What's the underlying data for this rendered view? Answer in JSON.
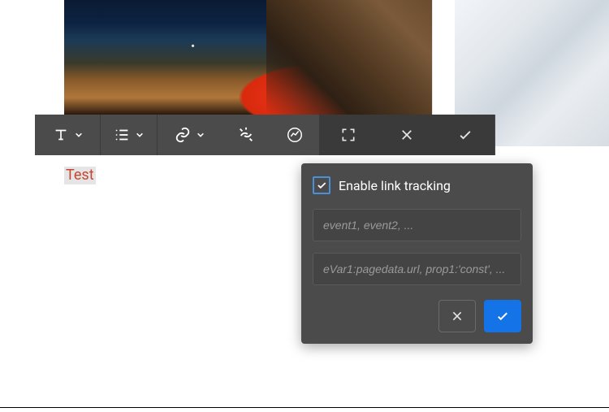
{
  "toolbar": {
    "icons": {
      "text": "text-format-icon",
      "list": "list-icon",
      "link": "link-icon",
      "unlink": "unlink-icon",
      "analytics": "analytics-icon",
      "fullscreen": "fullscreen-icon",
      "cancel": "close-icon",
      "confirm": "check-icon"
    }
  },
  "content": {
    "sample_text": "Test"
  },
  "popover": {
    "checkbox_checked": true,
    "checkbox_label": "Enable link tracking",
    "events_value": "",
    "events_placeholder": "event1, event2, ...",
    "vars_value": "",
    "vars_placeholder": "eVar1:pagedata.url, prop1:'const', ..."
  },
  "colors": {
    "toolbar_bg": "#4b4b4b",
    "primary": "#1473e6",
    "link_text": "#c74632"
  }
}
